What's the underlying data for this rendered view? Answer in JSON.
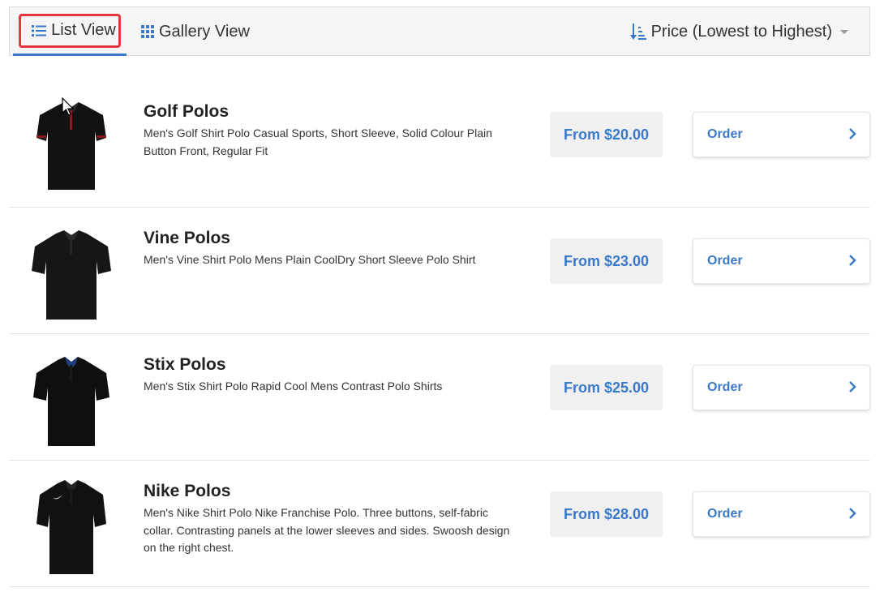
{
  "toolbar": {
    "tab_list": "List View",
    "tab_gallery": "Gallery View",
    "sort_label": "Price (Lowest to Highest)"
  },
  "accent_color": "#3a78c9",
  "highlight_color": "#e4373d",
  "products": [
    {
      "title": "Golf Polos",
      "description": "Men's Golf Shirt Polo Casual Sports, Short Sleeve, Solid Colour Plain Button Front, Regular Fit",
      "price": "From $20.00",
      "order_label": "Order",
      "image_icon": "golf-polo-shirt"
    },
    {
      "title": "Vine Polos",
      "description": "Men's Vine Shirt Polo Mens Plain CoolDry Short Sleeve Polo Shirt",
      "price": "From $23.00",
      "order_label": "Order",
      "image_icon": "vine-polo-shirt"
    },
    {
      "title": "Stix Polos",
      "description": "Men's Stix Shirt Polo Rapid Cool Mens Contrast Polo Shirts",
      "price": "From $25.00",
      "order_label": "Order",
      "image_icon": "stix-polo-shirt"
    },
    {
      "title": "Nike Polos",
      "description": "Men's Nike Shirt Polo Nike Franchise Polo. Three buttons, self-fabric collar. Contrasting panels at the lower sleeves and sides. Swoosh design on the right chest.",
      "price": "From $28.00",
      "order_label": "Order",
      "image_icon": "nike-polo-shirt"
    }
  ]
}
